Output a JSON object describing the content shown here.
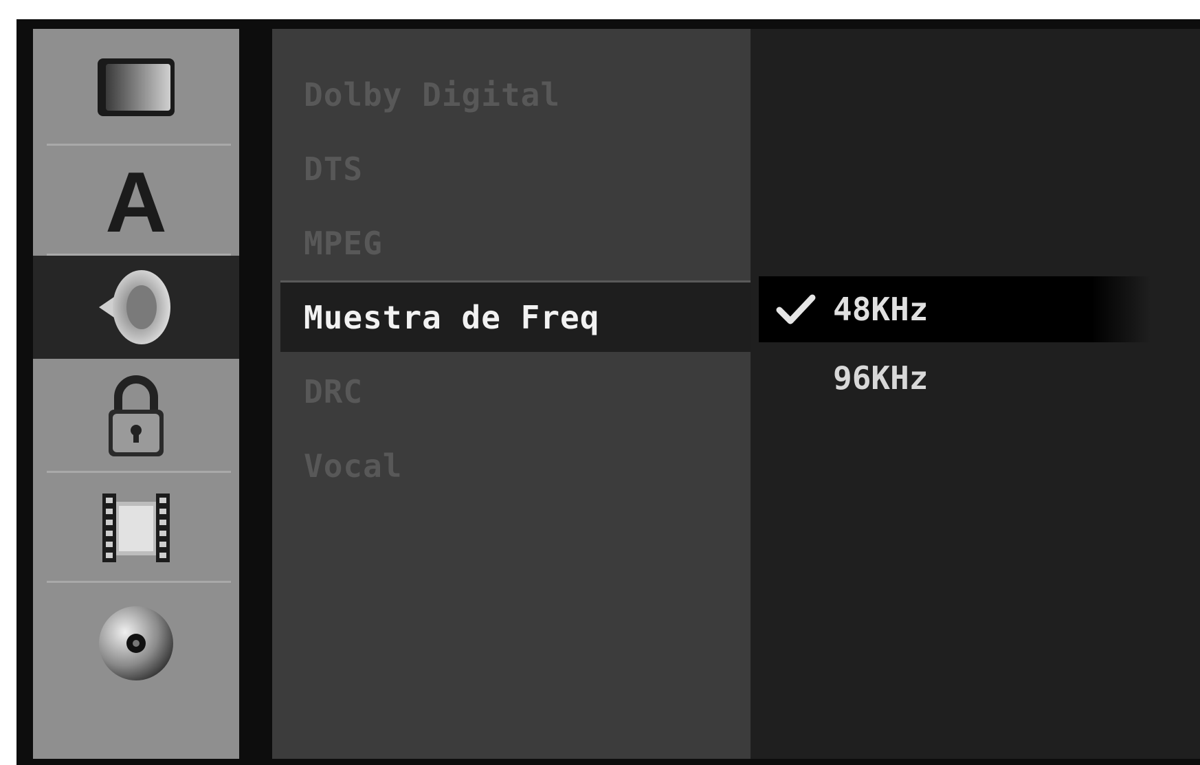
{
  "sidebar": {
    "icons": [
      {
        "name": "picture-icon",
        "active": false
      },
      {
        "name": "language-icon",
        "glyph": "A",
        "active": false
      },
      {
        "name": "audio-speaker-icon",
        "active": true
      },
      {
        "name": "lock-icon",
        "active": false
      },
      {
        "name": "film-icon",
        "active": false
      },
      {
        "name": "disc-icon",
        "active": false
      }
    ]
  },
  "menu": {
    "items": [
      {
        "label": "Dolby Digital",
        "enabled": false
      },
      {
        "label": "DTS",
        "enabled": false
      },
      {
        "label": "MPEG",
        "enabled": false
      },
      {
        "label": "Muestra de Freq",
        "enabled": true,
        "selected": true
      },
      {
        "label": "DRC",
        "enabled": false
      },
      {
        "label": "Vocal",
        "enabled": false
      }
    ]
  },
  "options": {
    "items": [
      {
        "label": "48KHz",
        "checked": true,
        "selected": true
      },
      {
        "label": "96KHz",
        "checked": false,
        "selected": false
      }
    ],
    "check_icon": "check-icon"
  },
  "colors": {
    "background": "#0d0d0d",
    "icon_column": "#8f8f8f",
    "icon_active": "#262626",
    "menu_panel": "#3c3c3c",
    "menu_disabled_text": "#585858",
    "menu_selected_bg": "#1e1e1e",
    "menu_selected_text": "#f2f2f2",
    "option_panel": "#1f1f1f",
    "option_selected_bg": "#000000"
  }
}
